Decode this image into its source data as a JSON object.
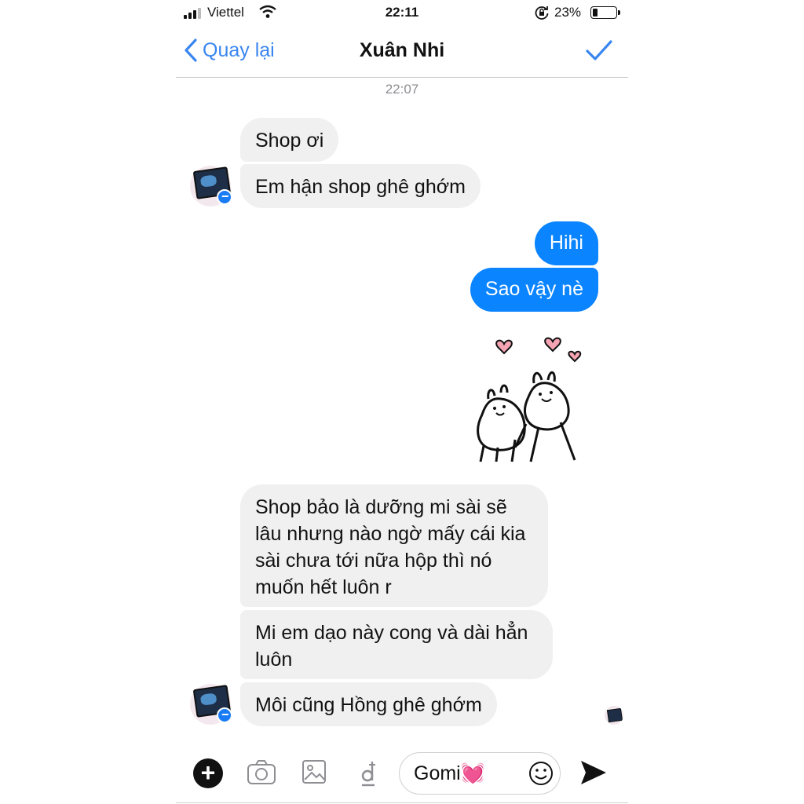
{
  "status_bar": {
    "carrier": "Viettel",
    "time": "22:11",
    "battery_percent": "23%",
    "battery_level": 0.23
  },
  "nav": {
    "back_label": "Quay lại",
    "title": "Xuân Nhi",
    "done_icon": "checkmark-icon",
    "accent_color": "#3a86f0"
  },
  "conversation": {
    "timestamp": "22:07",
    "messages": [
      {
        "sender": "contact",
        "text": "Shop ơi"
      },
      {
        "sender": "contact",
        "text": "Em hận shop ghê ghớm"
      },
      {
        "sender": "me",
        "text": "Hihi"
      },
      {
        "sender": "me",
        "text": "Sao vậy nè"
      },
      {
        "sender": "me",
        "type": "sticker",
        "sticker": "two-bunnies-hearts"
      },
      {
        "sender": "contact",
        "text": "Shop bảo là dưỡng mi sài sẽ lâu nhưng nào ngờ mấy cái kia sài chưa tới nữa hộp thì nó muốn hết luôn r"
      },
      {
        "sender": "contact",
        "text": "Mi em dạo này cong và dài hẳn luôn"
      },
      {
        "sender": "contact",
        "text": "Môi cũng Hồng ghê ghớm"
      }
    ],
    "incoming_bubble_color": "#f0f0f0",
    "outgoing_bubble_color": "#0a84ff"
  },
  "composer": {
    "value": "Gomi💓",
    "icons": [
      "plus-icon",
      "camera-icon",
      "image-icon",
      "dong-currency-icon",
      "emoji-icon",
      "send-icon"
    ]
  }
}
